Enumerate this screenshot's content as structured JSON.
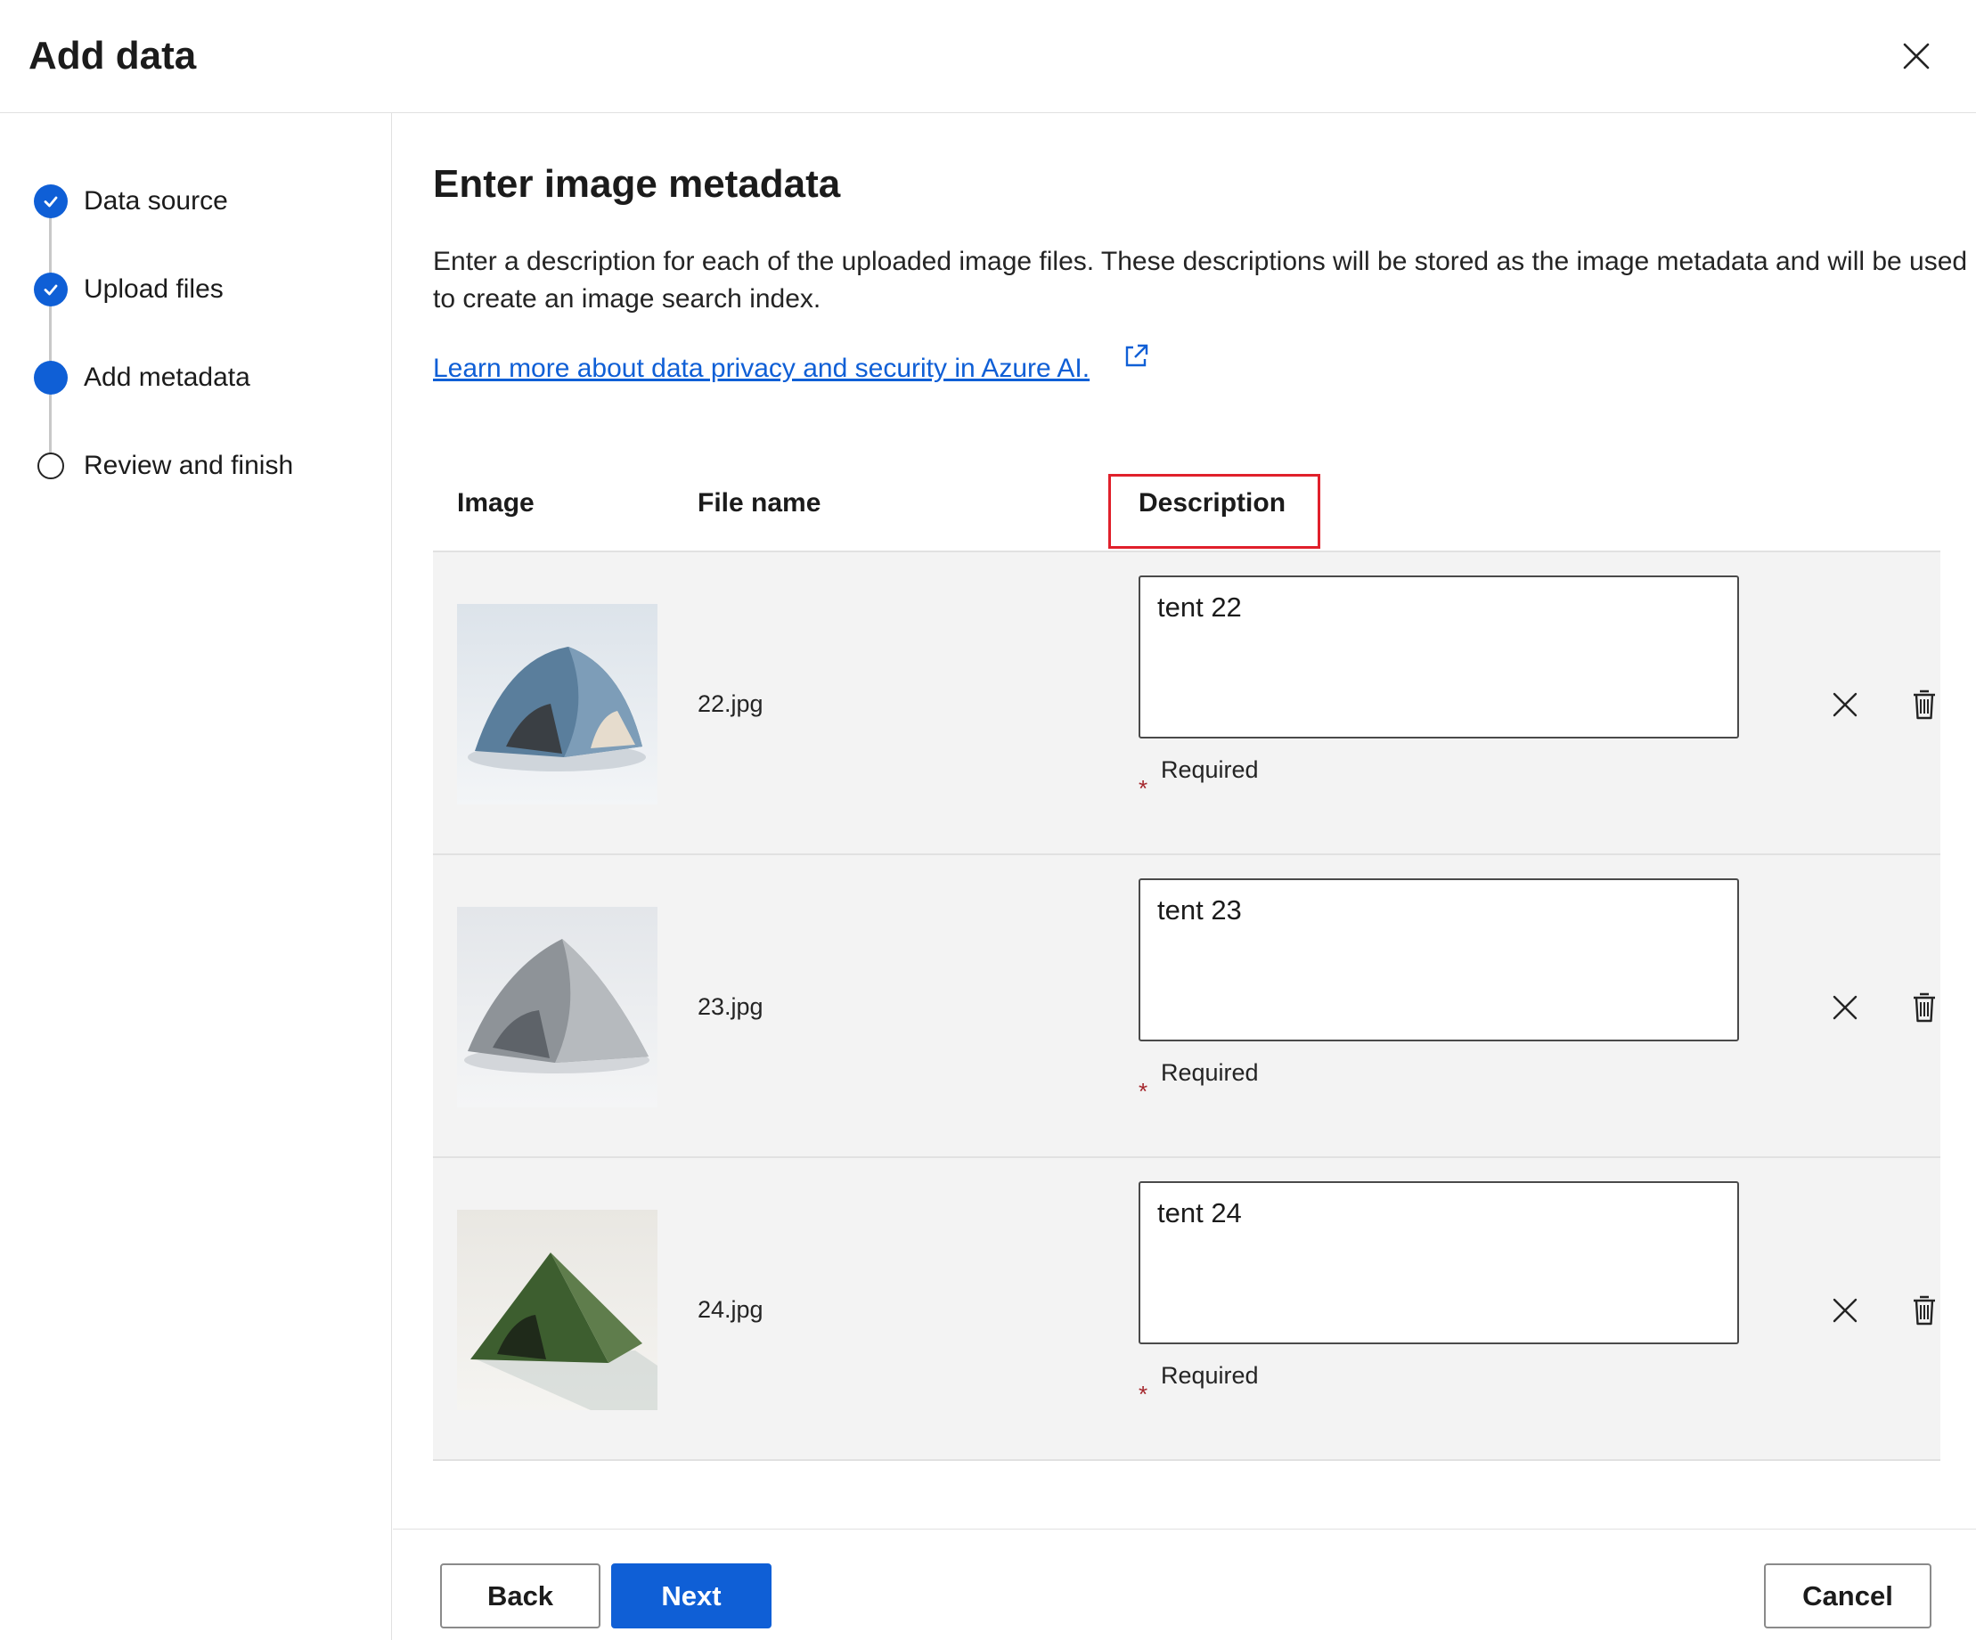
{
  "dialog": {
    "title": "Add data"
  },
  "steps": [
    {
      "label": "Data source",
      "status": "completed"
    },
    {
      "label": "Upload files",
      "status": "completed"
    },
    {
      "label": "Add metadata",
      "status": "current"
    },
    {
      "label": "Review and finish",
      "status": "pending"
    }
  ],
  "main": {
    "heading": "Enter image metadata",
    "intro": "Enter a description for each of the uploaded image files. These descriptions will be stored as the image metadata and will be used to create an image search index.",
    "learn_more": "Learn more about data privacy and security in Azure AI."
  },
  "table": {
    "columns": [
      "Image",
      "File name",
      "Description"
    ],
    "required_label": "Required",
    "required_marker": "*",
    "rows": [
      {
        "file_name": "22.jpg",
        "description": "tent 22",
        "tent_color": "#5a7e9c"
      },
      {
        "file_name": "23.jpg",
        "description": "tent 23",
        "tent_color": "#8e9398"
      },
      {
        "file_name": "24.jpg",
        "description": "tent 24",
        "tent_color": "#3d5e2f"
      }
    ]
  },
  "footer": {
    "back": "Back",
    "next": "Next",
    "cancel": "Cancel"
  },
  "colors": {
    "accent": "#0f5fd6",
    "highlight": "#e0202b",
    "required": "#a4262c",
    "row_background": "#f3f3f3"
  }
}
